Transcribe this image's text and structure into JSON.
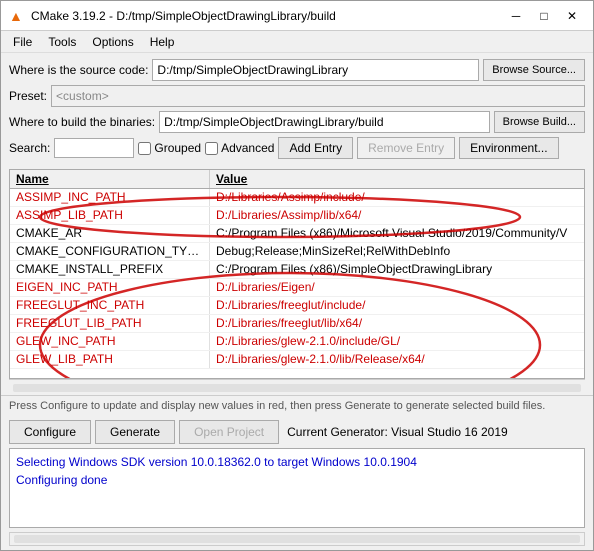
{
  "titleBar": {
    "title": "CMake 3.19.2 - D:/tmp/SimpleObjectDrawingLibrary/build",
    "icon": "▲",
    "minimizeLabel": "─",
    "maximizeLabel": "□",
    "closeLabel": "✕"
  },
  "menuBar": {
    "items": [
      "File",
      "Tools",
      "Options",
      "Help"
    ]
  },
  "form": {
    "sourceLabel": "Where is the source code:",
    "sourceValue": "D:/tmp/SimpleObjectDrawingLibrary",
    "sourceBrowse": "Browse Source...",
    "presetLabel": "Preset:",
    "presetValue": "<custom>",
    "buildLabel": "Where to build the binaries:",
    "buildValue": "D:/tmp/SimpleObjectDrawingLibrary/build",
    "buildBrowse": "Browse Build...",
    "searchLabel": "Search:",
    "searchValue": "",
    "groupedLabel": "Grouped",
    "advancedLabel": "Advanced",
    "addEntryLabel": "Add Entry",
    "removeEntryLabel": "Remove Entry",
    "environmentLabel": "Environment..."
  },
  "table": {
    "headers": [
      "Name",
      "Value"
    ],
    "rows": [
      {
        "name": "ASSIMP_INC_PATH",
        "value": "D:/Libraries/Assimp/include/",
        "red": true
      },
      {
        "name": "ASSIMP_LIB_PATH",
        "value": "D:/Libraries/Assimp/lib/x64/",
        "red": true
      },
      {
        "name": "CMAKE_AR",
        "value": "C:/Program Files (x86)/Microsoft Visual Studio/2019/Community/V",
        "red": false
      },
      {
        "name": "CMAKE_CONFIGURATION_TYPES",
        "value": "Debug;Release;MinSizeRel;RelWithDebInfo",
        "red": false
      },
      {
        "name": "CMAKE_INSTALL_PREFIX",
        "value": "C:/Program Files (x86)/SimpleObjectDrawingLibrary",
        "red": false
      },
      {
        "name": "EIGEN_INC_PATH",
        "value": "D:/Libraries/Eigen/",
        "red": true
      },
      {
        "name": "FREEGLUT_INC_PATH",
        "value": "D:/Libraries/freeglut/include/",
        "red": true
      },
      {
        "name": "FREEGLUT_LIB_PATH",
        "value": "D:/Libraries/freeglut/lib/x64/",
        "red": true
      },
      {
        "name": "GLEW_INC_PATH",
        "value": "D:/Libraries/glew-2.1.0/include/GL/",
        "red": true
      },
      {
        "name": "GLEW_LIB_PATH",
        "value": "D:/Libraries/glew-2.1.0/lib/Release/x64/",
        "red": true
      }
    ]
  },
  "statusBar": {
    "text": "Press Configure to update and display new values in red, then press Generate to generate selected build files."
  },
  "bottomButtons": {
    "configure": "Configure",
    "generate": "Generate",
    "openProject": "Open Project",
    "generatorLabel": "Current Generator: Visual Studio 16 2019"
  },
  "log": {
    "lines": [
      {
        "text": "Selecting Windows SDK version 10.0.18362.0 to target Windows 10.0.1904",
        "class": "log-blue"
      },
      {
        "text": "Configuring done",
        "class": "log-blue"
      }
    ]
  }
}
